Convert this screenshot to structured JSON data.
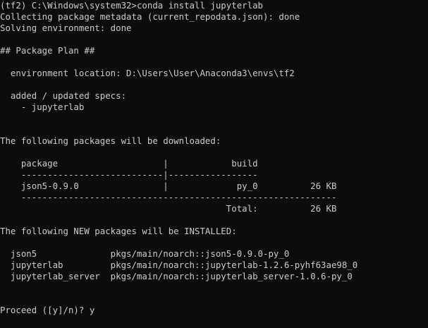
{
  "terminal": {
    "lines": [
      "(tf2) C:\\Windows\\system32>conda install jupyterlab",
      "Collecting package metadata (current_repodata.json): done",
      "Solving environment: done",
      "",
      "## Package Plan ##",
      "",
      "  environment location: D:\\Users\\User\\Anaconda3\\envs\\tf2",
      "",
      "  added / updated specs:",
      "    - jupyterlab",
      "",
      "",
      "The following packages will be downloaded:",
      "",
      "    package                    |            build",
      "    ---------------------------|-----------------",
      "    json5-0.9.0                |             py_0          26 KB",
      "    ------------------------------------------------------------",
      "                                           Total:          26 KB",
      "",
      "The following NEW packages will be INSTALLED:",
      "",
      "  json5              pkgs/main/noarch::json5-0.9.0-py_0",
      "  jupyterlab         pkgs/main/noarch::jupyterlab-1.2.6-pyhf63ae98_0",
      "  jupyterlab_server  pkgs/main/noarch::jupyterlab_server-1.0.6-py_0",
      "",
      "",
      "Proceed ([y]/n)? y"
    ]
  }
}
